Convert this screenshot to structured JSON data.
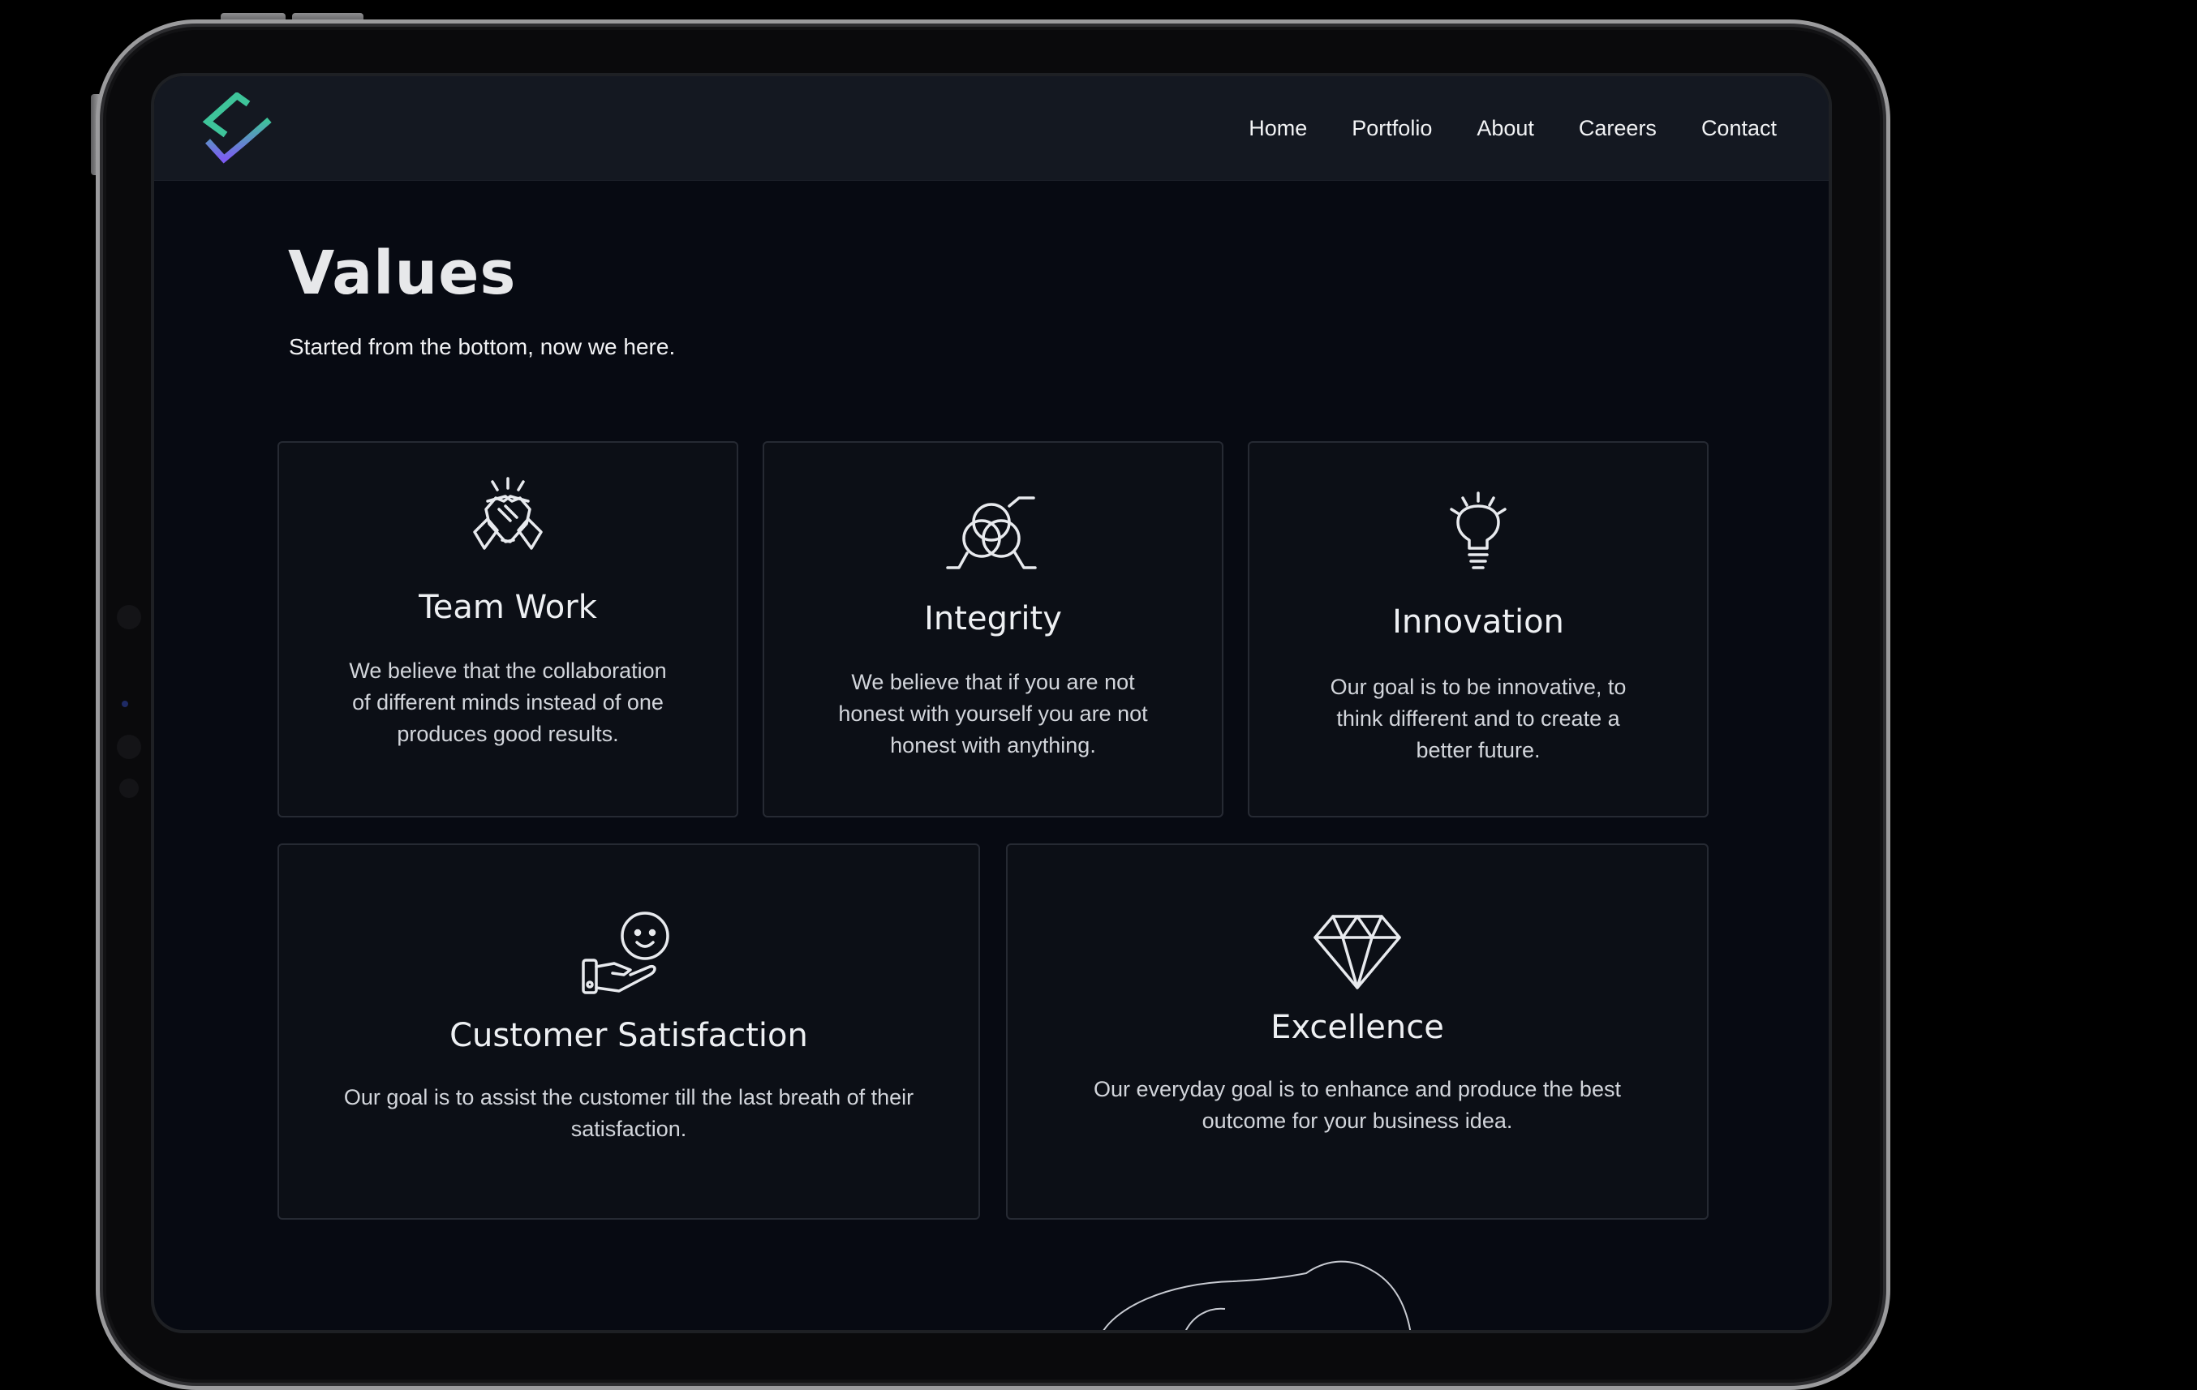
{
  "nav": {
    "logo": "logo-icon",
    "links": [
      "Home",
      "Portfolio",
      "About",
      "Careers",
      "Contact"
    ]
  },
  "header": {
    "title": "Values",
    "subtitle": "Started from the bottom, now we here."
  },
  "values": [
    {
      "icon": "handshake-icon",
      "title": "Team Work",
      "text": "We believe that the collaboration of different minds instead of one produces good results."
    },
    {
      "icon": "venn-diagram-icon",
      "title": "Integrity",
      "text": "We believe that if you are not honest with yourself you are not honest with anything."
    },
    {
      "icon": "lightbulb-icon",
      "title": "Innovation",
      "text": "Our goal is to be innovative, to think different and to create a better future."
    },
    {
      "icon": "smiley-hand-icon",
      "title": "Customer Satisfaction",
      "text": "Our goal is to assist the customer till the last breath of their satisfaction."
    },
    {
      "icon": "diamond-icon",
      "title": "Excellence",
      "text": "Our everyday goal is to enhance and produce the best outcome for your business idea."
    }
  ],
  "colors": {
    "background": "#070a12",
    "navbar": "#141821",
    "card": "#0c0f16",
    "card_border": "#262a33",
    "logo_green": "#3ec49a",
    "logo_purple": "#7c5cf2"
  }
}
